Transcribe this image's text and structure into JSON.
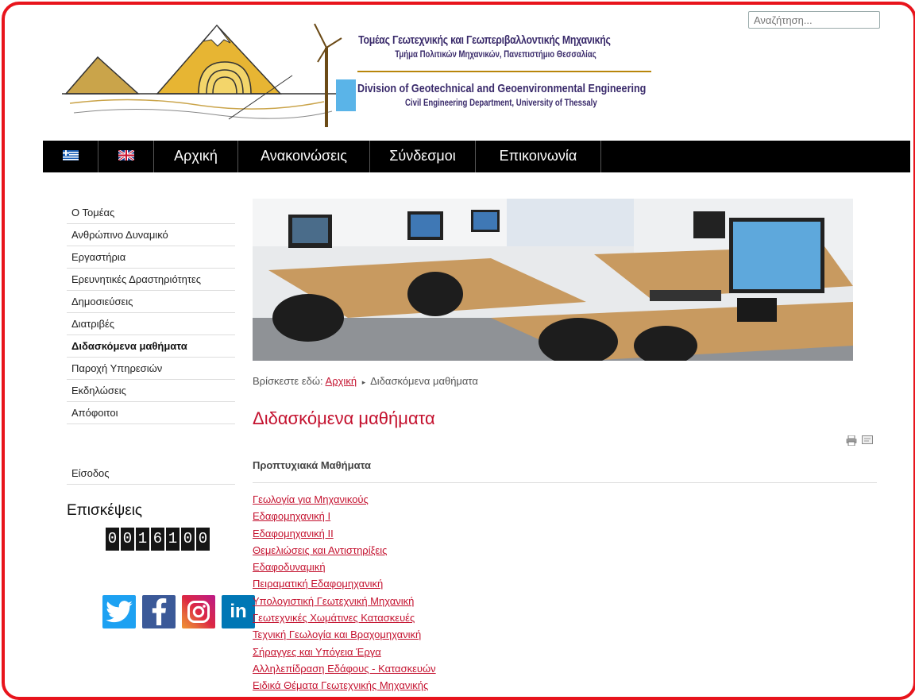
{
  "header": {
    "title_gr": "Τομέας Γεωτεχνικής και Γεωπεριβαλλοντικής Μηχανικής",
    "subtitle_gr": "Τμήμα Πολιτικών Μηχανικών, Πανεπιστήμιο Θεσσαλίας",
    "title_en": "Division of Geotechnical and Geoenvironmental Engineering",
    "subtitle_en": "Civil Engineering Department, University of Thessaly",
    "search_placeholder": "Αναζήτηση..."
  },
  "nav": {
    "items": [
      "Αρχική",
      "Ανακοινώσεις",
      "Σύνδεσμοι",
      "Επικοινωνία"
    ]
  },
  "sidebar": {
    "items": [
      "Ο Τομέας",
      "Ανθρώπινο Δυναμικό",
      "Εργαστήρια",
      "Ερευνητικές Δραστηριότητες",
      "Δημοσιεύσεις",
      "Διατριβές",
      "Διδασκόμενα μαθήματα",
      "Παροχή Υπηρεσιών",
      "Εκδηλώσεις",
      "Απόφοιτοι"
    ],
    "active_index": 6,
    "login": "Είσοδος",
    "visits_title": "Επισκέψεις",
    "counter_digits": [
      "0",
      "0",
      "1",
      "6",
      "1",
      "0",
      "0"
    ],
    "social": [
      "twitter-icon",
      "facebook-icon",
      "instagram-icon",
      "linkedin-icon"
    ]
  },
  "content": {
    "breadcrumb_prefix": "Βρίσκεστε εδώ:",
    "breadcrumb_home": "Αρχική",
    "breadcrumb_current": "Διδασκόμενα μαθήματα",
    "page_title": "Διδασκόμενα μαθήματα",
    "section_title": "Προπτυχιακά Μαθήματα",
    "courses": [
      "Γεωλογία για Μηχανικούς",
      "Εδαφομηχανική Ι",
      "Εδαφομηχανική ΙΙ",
      "Θεμελιώσεις και Αντιστηρίξεις",
      "Εδαφοδυναμική",
      "Πειραματική Εδαφομηχανική",
      "Υπολογιστική Γεωτεχνική Μηχανική",
      "Γεωτεχνικές Χωμάτινες Κατασκευές",
      "Τεχνική Γεωλογία και Βραχομηχανική",
      "Σήραγγες και Υπόγεια Έργα",
      "Αλληλεπίδραση Εδάφους - Κατασκευών",
      "Ειδικά Θέματα Γεωτεχνικής Μηχανικής"
    ]
  },
  "colors": {
    "accent": "#c4122f",
    "frame": "#e8141c",
    "nav_bg": "#000000"
  }
}
